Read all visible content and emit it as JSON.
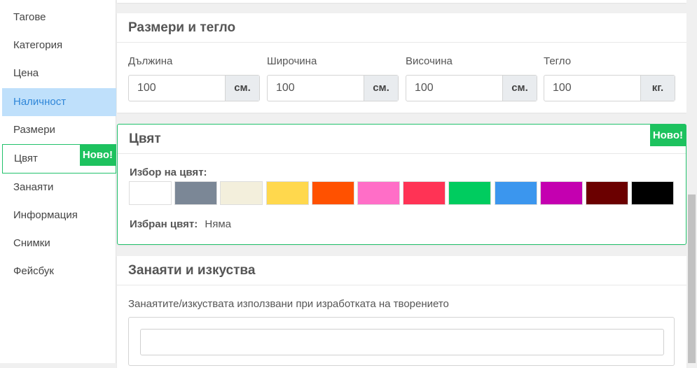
{
  "sidebar": {
    "items": [
      {
        "label": "Тагове"
      },
      {
        "label": "Категория"
      },
      {
        "label": "Цена"
      },
      {
        "label": "Наличност"
      },
      {
        "label": "Размери"
      },
      {
        "label": "Цвят",
        "badge": "Ново!"
      },
      {
        "label": "Занаяти"
      },
      {
        "label": "Информация"
      },
      {
        "label": "Снимки"
      },
      {
        "label": "Фейсбук"
      }
    ]
  },
  "dimensions": {
    "title": "Размери и тегло",
    "fields": [
      {
        "label": "Дължина",
        "value": "100",
        "unit": "см."
      },
      {
        "label": "Широчина",
        "value": "100",
        "unit": "см."
      },
      {
        "label": "Височина",
        "value": "100",
        "unit": "см."
      },
      {
        "label": "Тегло",
        "value": "100",
        "unit": "кг."
      }
    ]
  },
  "color": {
    "title": "Цвят",
    "badge": "Ново!",
    "pick_label": "Избор на цвят:",
    "swatches": [
      "#ffffff",
      "#7b8796",
      "#f3efdc",
      "#ffd84d",
      "#ff5100",
      "#ff6ec7",
      "#ff3355",
      "#00cc5f",
      "#3b96ee",
      "#c400b0",
      "#6b0000",
      "#000000"
    ],
    "chosen_label": "Избран цвят:",
    "chosen_value": "Няма"
  },
  "crafts": {
    "title": "Занаяти и изкуства",
    "description": "Занаятите/изкуствата използвани при изработката на творението"
  }
}
